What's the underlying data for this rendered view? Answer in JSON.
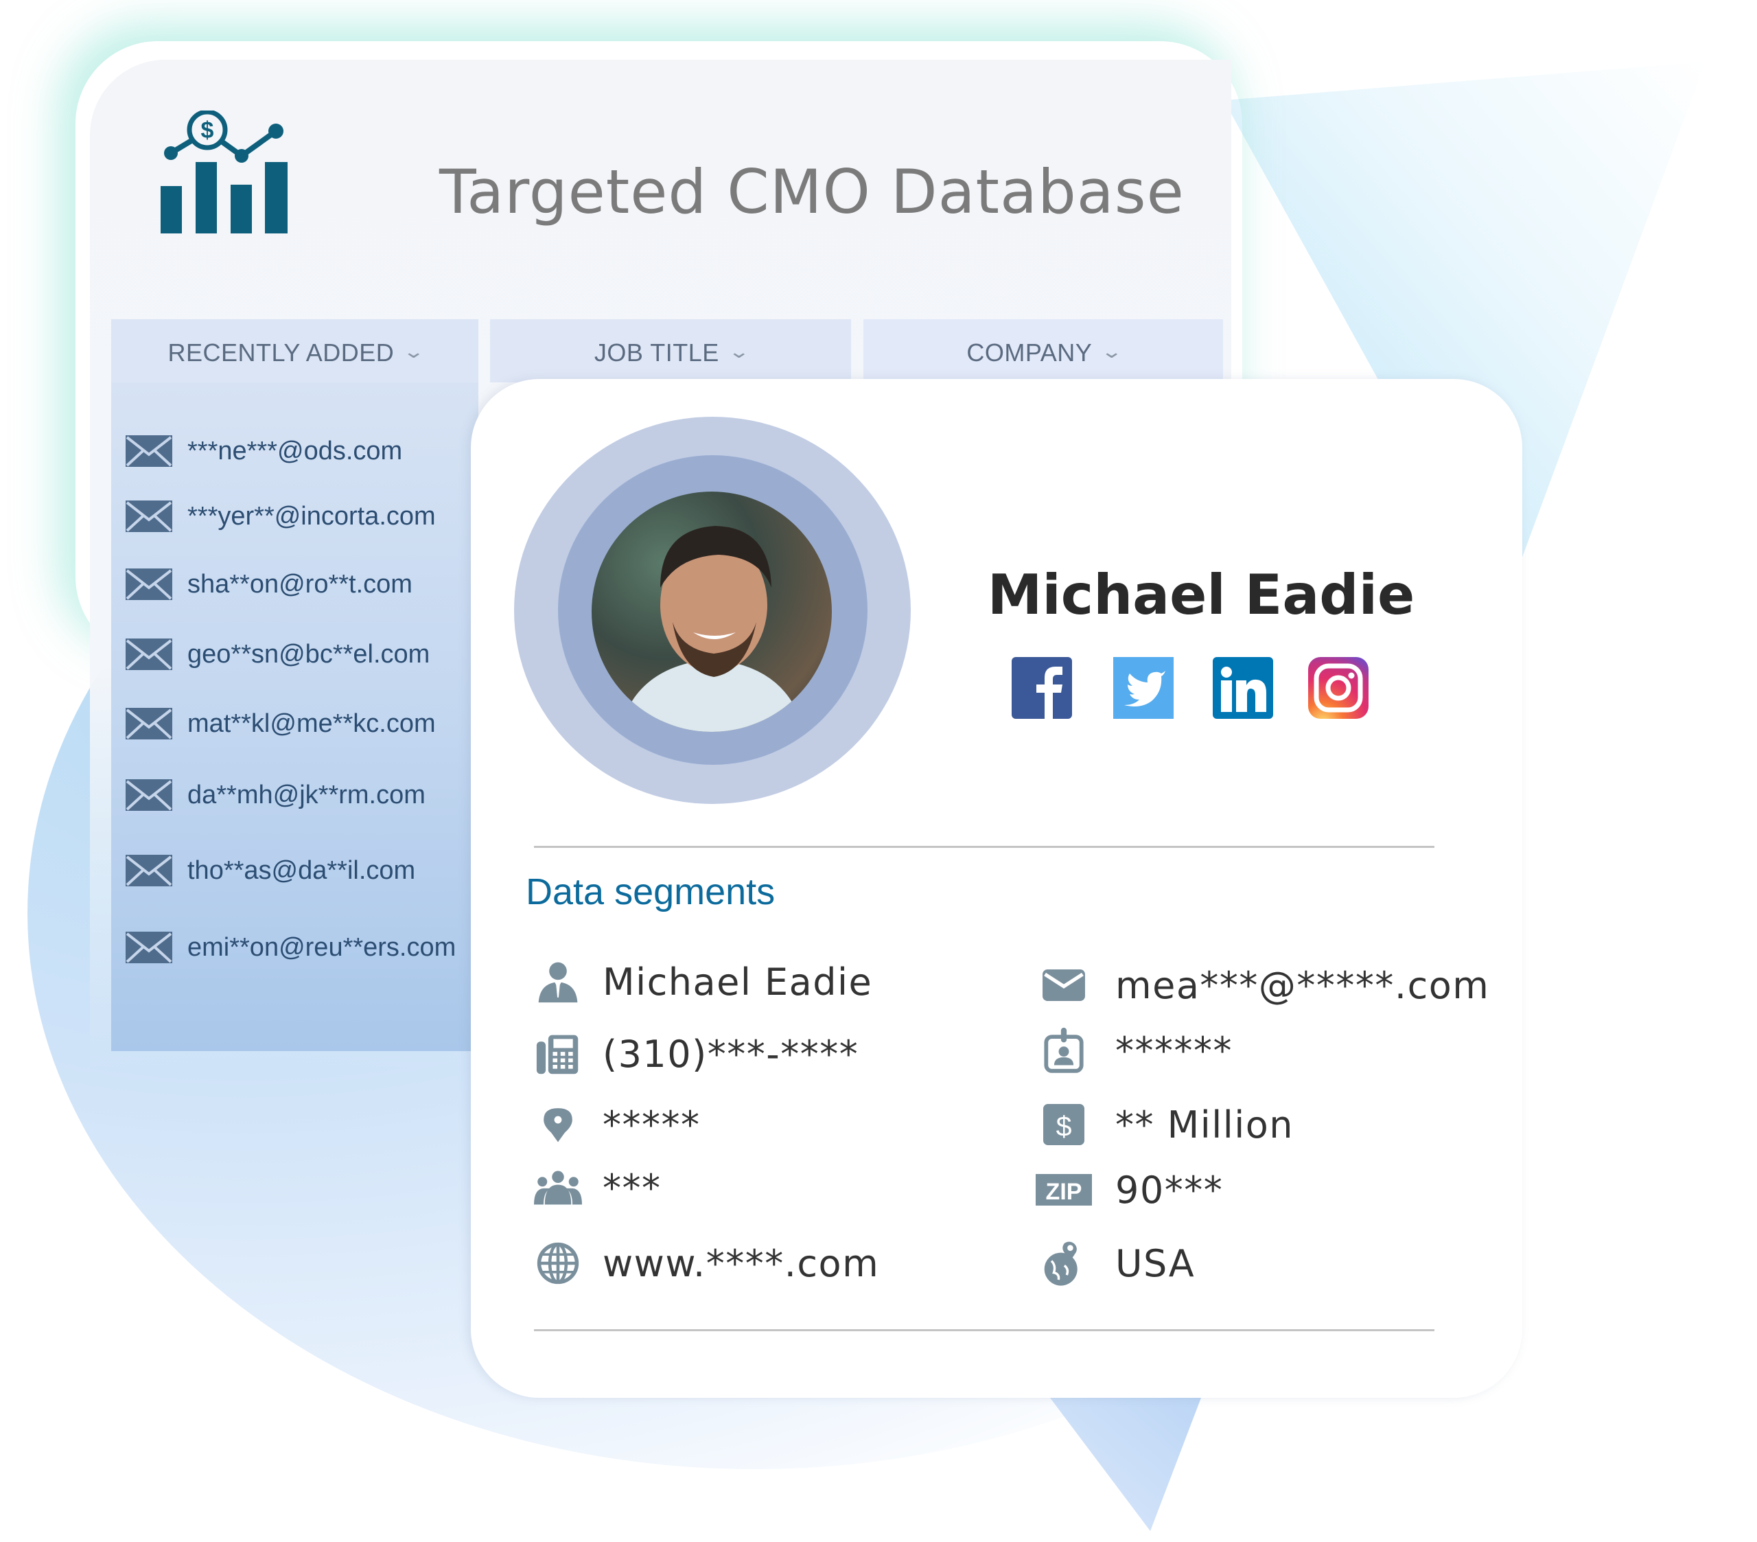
{
  "header": {
    "title": "Targeted CMO Database",
    "logo_icon": "bar-chart-dollar-icon"
  },
  "tabs": [
    {
      "label": "RECENTLY ADDED",
      "icon": "chevron-down-icon"
    },
    {
      "label": "JOB TITLE",
      "icon": "chevron-down-icon"
    },
    {
      "label": "COMPANY",
      "icon": "chevron-down-icon"
    }
  ],
  "recent_emails": [
    "***ne***@ods.com",
    "***yer**@incorta.com",
    "sha**on@ro**t.com",
    "geo**sn@bc**el.com",
    "mat**kl@me**kc.com",
    "da**mh@jk**rm.com",
    "tho**as@da**il.com",
    "emi**on@reu**ers.com"
  ],
  "profile": {
    "name": "Michael Eadie",
    "social": [
      {
        "name": "facebook",
        "color": "#3b5998"
      },
      {
        "name": "twitter",
        "color": "#55acee"
      },
      {
        "name": "linkedin",
        "color": "#0077b5"
      },
      {
        "name": "instagram",
        "color": "#e1306c"
      }
    ]
  },
  "data_segments": {
    "title": "Data segments",
    "left": [
      {
        "icon": "person-icon",
        "value": "Michael Eadie"
      },
      {
        "icon": "phone-icon",
        "value": "(310)***-****"
      },
      {
        "icon": "location-pin-icon",
        "value": "*****"
      },
      {
        "icon": "team-icon",
        "value": "***"
      },
      {
        "icon": "globe-icon",
        "value": "www.****.com"
      }
    ],
    "right": [
      {
        "icon": "envelope-icon",
        "value": "mea***@*****.com"
      },
      {
        "icon": "id-badge-icon",
        "value": "******"
      },
      {
        "icon": "dollar-icon",
        "value": "** Million"
      },
      {
        "icon": "zip-icon",
        "icon_label": "ZIP",
        "value": "90***"
      },
      {
        "icon": "globe-pin-icon",
        "value": "USA"
      }
    ]
  },
  "colors": {
    "accent": "#0c6b9c",
    "logo": "#0e5f7b",
    "icon_gray": "#7a8f9c",
    "sidebar_text": "#2c4d72"
  }
}
